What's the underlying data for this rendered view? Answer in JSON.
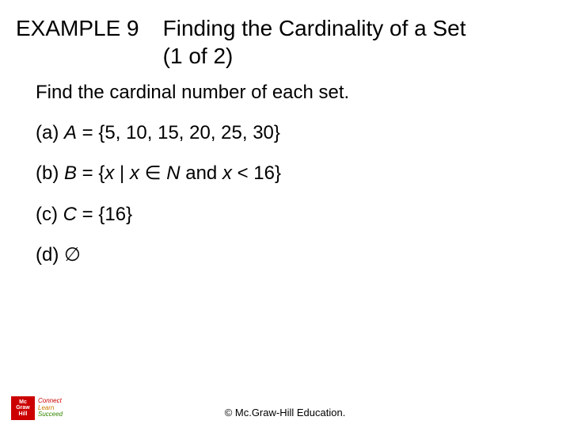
{
  "header": {
    "example_label": "EXAMPLE 9",
    "title_line1": "Finding the Cardinality of a Set",
    "title_line2": "(1 of 2)"
  },
  "body": {
    "instruction": "Find the cardinal number of each set.",
    "a_prefix": "(a) ",
    "a_var": "A",
    "a_rest": " = {5, 10, 15, 20, 25, 30}",
    "b_prefix": "(b) ",
    "b_var": "B",
    "b_open": " = {",
    "b_x1": "x",
    "b_bar": " | ",
    "b_x2": "x",
    "b_sp1": " ",
    "b_elem": "∈",
    "b_sp2": " ",
    "b_N": "N",
    "b_and": " and ",
    "b_x3": "x",
    "b_sp3": " ",
    "b_lt": "<",
    "b_tail": " 16}",
    "c_prefix": "(c) ",
    "c_var": "C",
    "c_rest": " = {16}",
    "d_prefix": "(d) ",
    "d_sym": "∅"
  },
  "footer": {
    "copyright": "© Mc.Graw-Hill Education.",
    "logo_l1": "Mc",
    "logo_l2": "Graw",
    "logo_l3": "Hill",
    "tag1": "Connect",
    "tag2": "Learn",
    "tag3": "Succeed"
  }
}
